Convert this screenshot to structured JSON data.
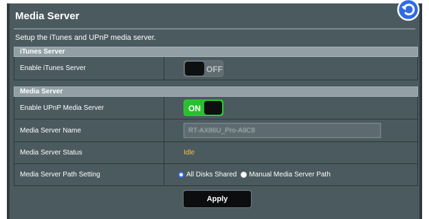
{
  "page": {
    "title": "Media Server",
    "subtitle": "Setup the iTunes and UPnP media server.",
    "back_icon": "back-arrow-icon"
  },
  "itunes_section": {
    "header": "iTunes Server",
    "enable_label": "Enable iTunes Server",
    "toggle_state": "OFF"
  },
  "media_section": {
    "header": "Media Server",
    "enable_upnp_label": "Enable UPnP Media Server",
    "upnp_toggle_state": "ON",
    "name_label": "Media Server Name",
    "name_value": "RT-AX86U_Pro-A9C8",
    "status_label": "Media Server Status",
    "status_value": "Idle",
    "path_label": "Media Server Path Setting",
    "path_options": [
      "All Disks Shared",
      "Manual Media Server Path"
    ],
    "path_selected": "All Disks Shared"
  },
  "actions": {
    "apply_label": "Apply"
  },
  "colors": {
    "panel_bg": "#4b5a5f",
    "header_bg": "#92a0a5",
    "toggle_on": "#29c02f",
    "status_color": "#f5c242",
    "radio_selected": "#2f6be6"
  }
}
